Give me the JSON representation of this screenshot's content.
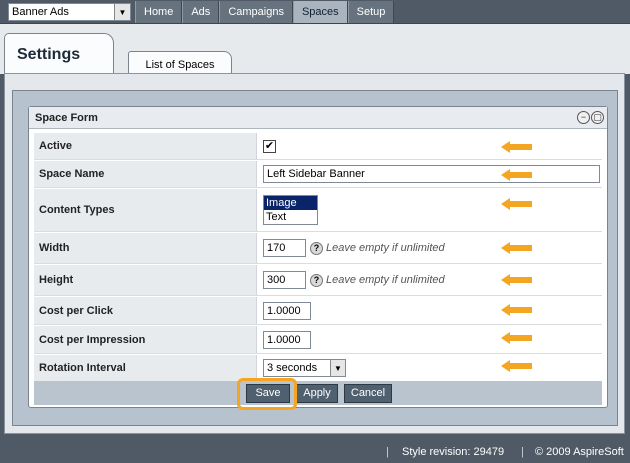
{
  "app_selector": {
    "value": "Banner Ads"
  },
  "nav": [
    "Home",
    "Ads",
    "Campaigns",
    "Spaces",
    "Setup"
  ],
  "nav_active": "Spaces",
  "tabs": {
    "settings": "Settings",
    "list_of_spaces": "List of Spaces"
  },
  "form": {
    "title": "Space Form",
    "title_buttons": {
      "minimize": "−",
      "restore": "▢"
    },
    "fields": {
      "active": {
        "label": "Active",
        "checked": true,
        "check_glyph": "✔"
      },
      "space_name": {
        "label": "Space Name",
        "value": "Left Sidebar Banner"
      },
      "content_types": {
        "label": "Content Types",
        "options": [
          "Image",
          "Text"
        ],
        "selected": "Image"
      },
      "width": {
        "label": "Width",
        "value": "170",
        "help_glyph": "?",
        "hint": "Leave empty if unlimited"
      },
      "height": {
        "label": "Height",
        "value": "300",
        "help_glyph": "?",
        "hint": "Leave empty if unlimited"
      },
      "cost_per_click": {
        "label": "Cost per Click",
        "value": "1.0000"
      },
      "cost_per_impression": {
        "label": "Cost per Impression",
        "value": "1.0000"
      },
      "rotation_interval": {
        "label": "Rotation Interval",
        "value": "3 seconds"
      }
    },
    "buttons": {
      "save": "Save",
      "apply": "Apply",
      "cancel": "Cancel"
    }
  },
  "footer": {
    "style_revision": "Style revision: 29479",
    "copyright": "© 2009 AspireSoft"
  },
  "colors": {
    "accent_arrow": "#f4a623",
    "highlight": "#f4a623",
    "button": "#4f6070",
    "topbar": "#4f5a66"
  }
}
